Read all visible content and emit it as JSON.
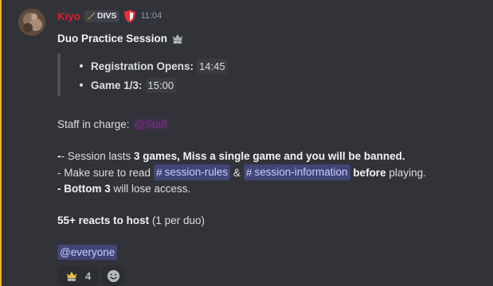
{
  "message": {
    "username": "Kiyo",
    "clan_tag": "DIVS",
    "timestamp": "11:04",
    "title": "Duo Practice Session",
    "schedule": [
      {
        "label": "Registration Opens:",
        "value": "14:45"
      },
      {
        "label": "Game 1/3:",
        "value": "15:00"
      }
    ],
    "staff_prefix": "Staff in charge:",
    "staff_role": "@Staff",
    "rule1": {
      "prefix": "- Session lasts ",
      "bold1": "3 games, Miss a single game and you will be banned."
    },
    "rule2": {
      "prefix": "- Make sure to read ",
      "channel1": "session-rules",
      "amp": "&",
      "channel2": "session-information",
      "bold": "before",
      "suffix": " playing."
    },
    "rule3": {
      "bold": "- Bottom 3",
      "suffix": " will lose access."
    },
    "host": {
      "bold": "55+ reacts to host",
      "suffix": "(1 per duo)"
    },
    "mention": "@everyone",
    "reaction": {
      "emoji_icon": "divs-crown-icon",
      "count": "4"
    },
    "add_reaction_icon": "smiley-icon"
  },
  "colors": {
    "background": "#323339",
    "username": "#e01e2b",
    "highlight": "#f0b232",
    "mention_bg": "#404675",
    "mention_fg": "#c9cdfb",
    "role_color": "#7a2b8c"
  }
}
